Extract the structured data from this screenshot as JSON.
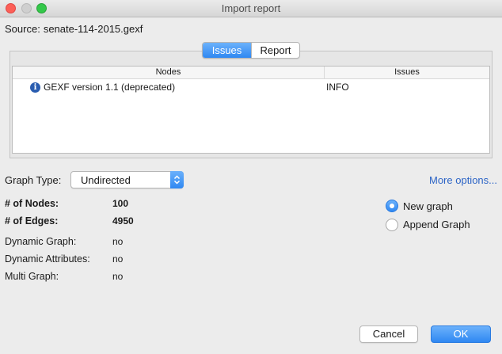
{
  "window": {
    "title": "Import report"
  },
  "source": {
    "label": "Source:",
    "value": "senate-114-2015.gexf"
  },
  "tabs": [
    {
      "label": "Issues",
      "active": true
    },
    {
      "label": "Report",
      "active": false
    }
  ],
  "issues_table": {
    "columns": [
      "Nodes",
      "Issues"
    ],
    "rows": [
      {
        "icon": "info-icon",
        "message": "GEXF version 1.1 (deprecated)",
        "level": "INFO"
      }
    ]
  },
  "graph_type": {
    "label": "Graph Type:",
    "selected": "Undirected"
  },
  "more_options": "More options...",
  "stats": {
    "nodes_label": "# of Nodes:",
    "nodes_value": "100",
    "edges_label": "# of Edges:",
    "edges_value": "4950",
    "dynamic_graph_label": "Dynamic Graph:",
    "dynamic_graph_value": "no",
    "dynamic_attributes_label": "Dynamic Attributes:",
    "dynamic_attributes_value": "no",
    "multi_graph_label": "Multi Graph:",
    "multi_graph_value": "no"
  },
  "radio_options": [
    {
      "label": "New graph",
      "selected": true
    },
    {
      "label": "Append Graph",
      "selected": false
    }
  ],
  "buttons": {
    "cancel": "Cancel",
    "ok": "OK"
  },
  "colors": {
    "accent": "#2f88f2",
    "link": "#2c64c6"
  }
}
